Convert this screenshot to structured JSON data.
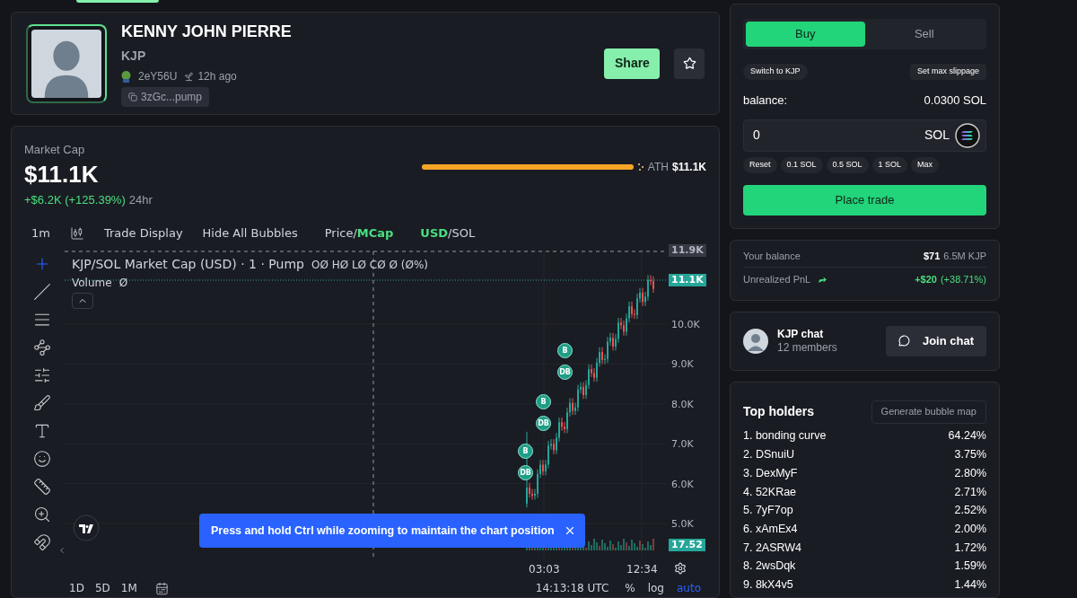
{
  "token": {
    "name": "KENNY JOHN PIERRE",
    "ticker": "KJP",
    "creator": "2eY56U",
    "age": "12h ago",
    "address": "3zGc...pump",
    "share": "Share",
    "favorite": false
  },
  "market": {
    "label": "Market Cap",
    "value": "$11.1K",
    "change": "+$6.2K (+125.39%)",
    "period": "24hr",
    "ath_label": "ATH",
    "ath_value": "$11.1K",
    "level": 1
  },
  "chart_toolbar": {
    "interval": "1m",
    "trade_display": "Trade Display",
    "hide_bubbles": "Hide All Bubbles",
    "price_mcap": [
      {
        "label": "Price",
        "selected": false
      },
      {
        "label": "MCap",
        "selected": true
      }
    ],
    "currency": [
      {
        "label": "USD",
        "selected": true
      },
      {
        "label": "SOL",
        "selected": false
      }
    ],
    "separator": "/"
  },
  "chart": {
    "title": "KJP/SOL Market Cap (USD) · 1 · Pump",
    "ohlc": "OØ HØ LØ CØ Ø (Ø%)",
    "volume_label": "Volume",
    "volume_value": "Ø",
    "top_tag": "11.9K",
    "last_tag": "11.1K",
    "price_labels": [
      "10.0K",
      "9.0K",
      "8.0K",
      "7.0K",
      "6.0K",
      "5.0K"
    ],
    "volume_tag": "17.52",
    "time_labels": [
      "03:03",
      "12:34"
    ],
    "bubbles": [
      {
        "label": "B"
      },
      {
        "label": "DB"
      },
      {
        "label": "B"
      },
      {
        "label": "DB"
      },
      {
        "label": "B"
      },
      {
        "label": "DB"
      }
    ],
    "toast": "Press and hold Ctrl while zooming to maintain the chart position"
  },
  "chart_footer": {
    "ranges": [
      "1D",
      "5D",
      "1M"
    ],
    "time": "14:13:18 UTC",
    "scales": [
      {
        "label": "%",
        "selected": false
      },
      {
        "label": "log",
        "selected": false
      },
      {
        "label": "auto",
        "selected": true
      }
    ]
  },
  "trade": {
    "tabs": [
      {
        "label": "Buy",
        "selected": true
      },
      {
        "label": "Sell",
        "selected": false
      }
    ],
    "switch": "Switch to KJP",
    "slippage": "Set max slippage",
    "balance_label": "balance:",
    "balance_value": "0.0300 SOL",
    "amount": "0",
    "currency": "SOL",
    "quick": [
      "Reset",
      "0.1 SOL",
      "0.5 SOL",
      "1 SOL",
      "Max"
    ],
    "submit": "Place trade"
  },
  "position": {
    "balance_label": "Your balance",
    "balance_usd": "$71",
    "balance_tokens": "6.5M KJP",
    "pnl_label": "Unrealized PnL",
    "pnl_value": "+$20",
    "pnl_percent": "(+38.71%)"
  },
  "chat": {
    "name": "KJP chat",
    "members": "12 members",
    "join": "Join chat"
  },
  "holders": {
    "title": "Top holders",
    "action": "Generate bubble map",
    "rows": [
      {
        "name": "1. bonding curve",
        "share": "64.24%"
      },
      {
        "name": "2. DSnuiU",
        "share": "3.75%"
      },
      {
        "name": "3. DexMyF",
        "share": "2.80%"
      },
      {
        "name": "4. 52KRae",
        "share": "2.71%"
      },
      {
        "name": "5. 7yF7op",
        "share": "2.52%"
      },
      {
        "name": "6. xAmEx4",
        "share": "2.00%"
      },
      {
        "name": "7. 2ASRW4",
        "share": "1.72%"
      },
      {
        "name": "8. 2wsDqk",
        "share": "1.59%"
      },
      {
        "name": "9. 8kX4v5",
        "share": "1.44%"
      }
    ]
  }
}
